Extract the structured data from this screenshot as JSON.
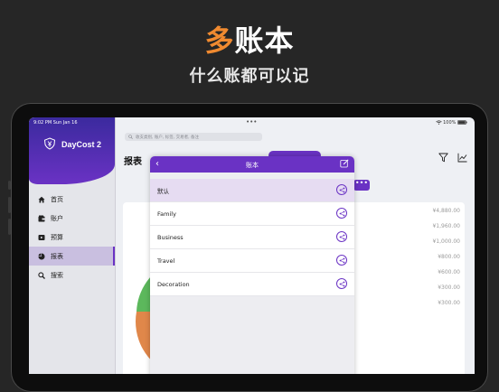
{
  "hero": {
    "title_accent": "多",
    "title_rest": "账本",
    "subtitle": "什么账都可以记"
  },
  "status_bar": {
    "time": "9:02 PM  Sun Jan 16",
    "battery": "100%"
  },
  "sidebar": {
    "app_name": "DayCost 2",
    "items": [
      {
        "label": "首页",
        "icon": "home-icon"
      },
      {
        "label": "账户",
        "icon": "wallet-icon"
      },
      {
        "label": "预算",
        "icon": "budget-icon"
      },
      {
        "label": "报表",
        "icon": "pie-chart-icon",
        "active": true
      },
      {
        "label": "搜索",
        "icon": "search-icon"
      }
    ]
  },
  "main": {
    "search_placeholder": "收支类别, 账户, 标签, 交易者, 备注",
    "title": "报表",
    "more_label": "•••",
    "amounts": [
      "¥4,880.00",
      "¥1,960.00",
      "¥1,000.00",
      "¥800.00",
      "¥600.00",
      "¥300.00",
      "¥300.00"
    ]
  },
  "modal": {
    "title": "账本",
    "books": [
      {
        "name": "默认",
        "selected": true
      },
      {
        "name": "Family",
        "selected": false
      },
      {
        "name": "Business",
        "selected": false
      },
      {
        "name": "Travel",
        "selected": false
      },
      {
        "name": "Decoration",
        "selected": false
      }
    ]
  },
  "colors": {
    "accent_orange": "#f08a30",
    "brand_purple": "#6a32c4",
    "selected_row": "#e6dcf2"
  }
}
